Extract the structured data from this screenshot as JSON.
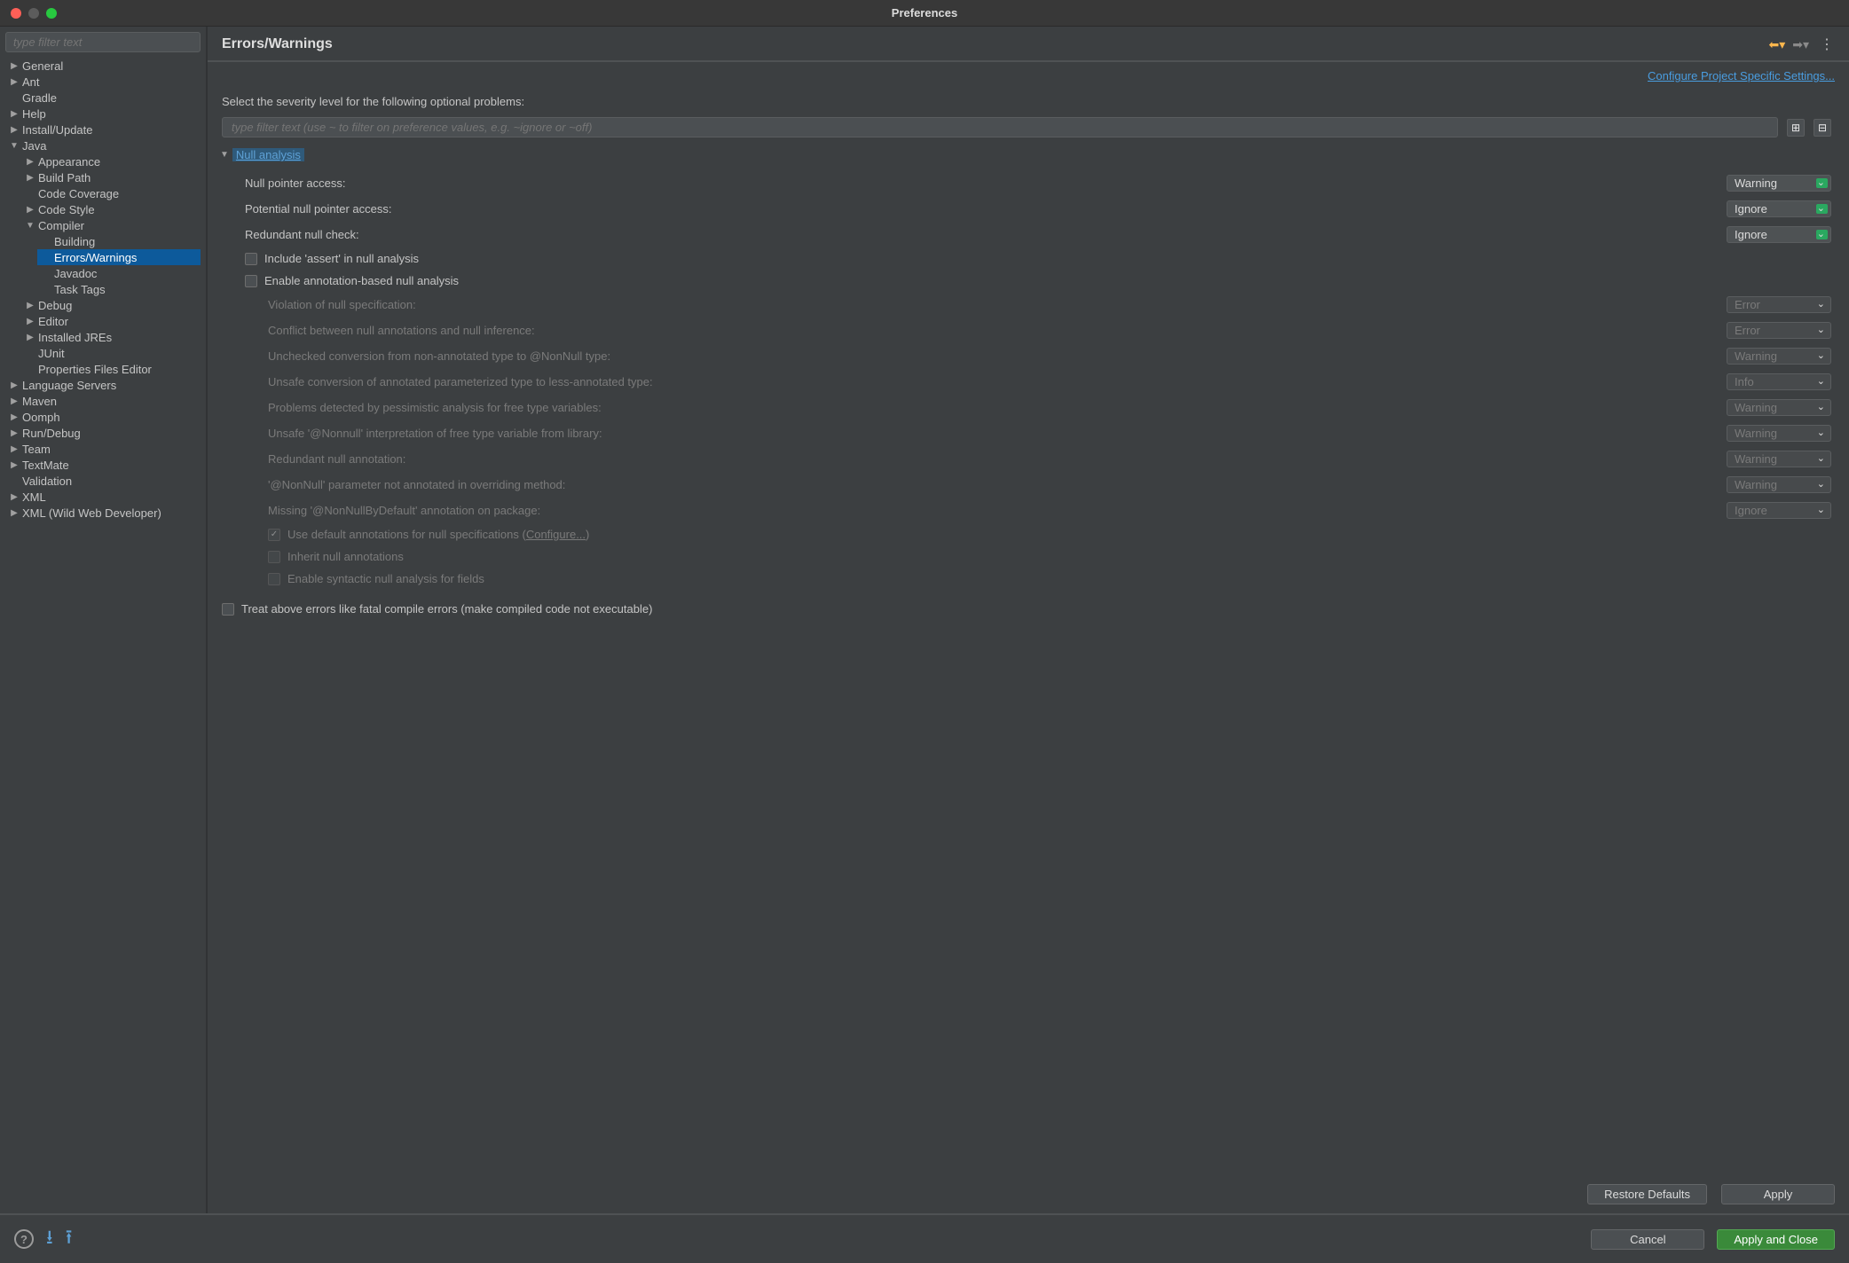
{
  "title": "Preferences",
  "sidebar": {
    "filter_placeholder": "type filter text",
    "tree": [
      {
        "label": "General",
        "expandable": true
      },
      {
        "label": "Ant",
        "expandable": true
      },
      {
        "label": "Gradle",
        "expandable": false
      },
      {
        "label": "Help",
        "expandable": true
      },
      {
        "label": "Install/Update",
        "expandable": true
      },
      {
        "label": "Java",
        "expandable": true,
        "expanded": true,
        "children": [
          {
            "label": "Appearance",
            "expandable": true
          },
          {
            "label": "Build Path",
            "expandable": true
          },
          {
            "label": "Code Coverage",
            "expandable": false
          },
          {
            "label": "Code Style",
            "expandable": true
          },
          {
            "label": "Compiler",
            "expandable": true,
            "expanded": true,
            "children": [
              {
                "label": "Building"
              },
              {
                "label": "Errors/Warnings",
                "selected": true
              },
              {
                "label": "Javadoc"
              },
              {
                "label": "Task Tags"
              }
            ]
          },
          {
            "label": "Debug",
            "expandable": true
          },
          {
            "label": "Editor",
            "expandable": true
          },
          {
            "label": "Installed JREs",
            "expandable": true
          },
          {
            "label": "JUnit",
            "expandable": false
          },
          {
            "label": "Properties Files Editor",
            "expandable": false
          }
        ]
      },
      {
        "label": "Language Servers",
        "expandable": true
      },
      {
        "label": "Maven",
        "expandable": true
      },
      {
        "label": "Oomph",
        "expandable": true
      },
      {
        "label": "Run/Debug",
        "expandable": true
      },
      {
        "label": "Team",
        "expandable": true
      },
      {
        "label": "TextMate",
        "expandable": true
      },
      {
        "label": "Validation",
        "expandable": false
      },
      {
        "label": "XML",
        "expandable": true
      },
      {
        "label": "XML (Wild Web Developer)",
        "expandable": true
      }
    ]
  },
  "header": {
    "heading": "Errors/Warnings",
    "config_link": "Configure Project Specific Settings..."
  },
  "content": {
    "prompt": "Select the severity level for the following optional problems:",
    "filter_placeholder": "type filter text (use ~ to filter on preference values, e.g. ~ignore or ~off)",
    "section": "Null analysis",
    "rows": {
      "r1": {
        "label": "Null pointer access:",
        "value": "Warning",
        "enabled": true
      },
      "r2": {
        "label": "Potential null pointer access:",
        "value": "Ignore",
        "enabled": true
      },
      "r3": {
        "label": "Redundant null check:",
        "value": "Ignore",
        "enabled": true
      }
    },
    "cb1": "Include 'assert' in null analysis",
    "cb2": "Enable annotation-based null analysis",
    "sub": {
      "s1": {
        "label": "Violation of null specification:",
        "value": "Error"
      },
      "s2": {
        "label": "Conflict between null annotations and null inference:",
        "value": "Error"
      },
      "s3": {
        "label": "Unchecked conversion from non-annotated type to @NonNull type:",
        "value": "Warning"
      },
      "s4": {
        "label": "Unsafe conversion of annotated parameterized type to less-annotated type:",
        "value": "Info"
      },
      "s5": {
        "label": "Problems detected by pessimistic analysis for free type variables:",
        "value": "Warning"
      },
      "s6": {
        "label": "Unsafe '@Nonnull' interpretation of free type variable from library:",
        "value": "Warning"
      },
      "s7": {
        "label": "Redundant null annotation:",
        "value": "Warning"
      },
      "s8": {
        "label": "'@NonNull' parameter not annotated in overriding method:",
        "value": "Warning"
      },
      "s9": {
        "label": "Missing '@NonNullByDefault' annotation on package:",
        "value": "Ignore"
      }
    },
    "subcb": {
      "c1": {
        "label": "Use default annotations for null specifications (",
        "link": "Configure...",
        "tail": ")",
        "checked": true
      },
      "c2": {
        "label": "Inherit null annotations"
      },
      "c3": {
        "label": "Enable syntactic null analysis for fields"
      }
    },
    "treat": "Treat above errors like fatal compile errors (make compiled code not executable)"
  },
  "buttons": {
    "restore": "Restore Defaults",
    "apply": "Apply",
    "cancel": "Cancel",
    "apply_close": "Apply and Close"
  }
}
